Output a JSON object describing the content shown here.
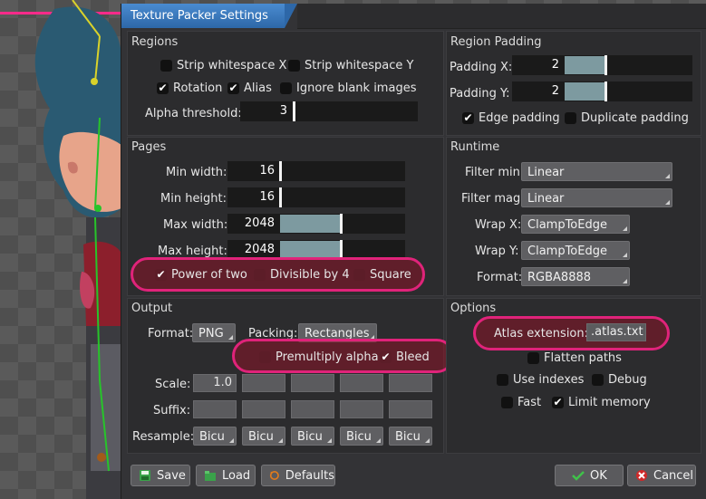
{
  "dialog": {
    "title": "Texture Packer Settings"
  },
  "regions": {
    "title": "Regions",
    "strip_x": {
      "label": "Strip whitespace X",
      "checked": false
    },
    "strip_y": {
      "label": "Strip whitespace Y",
      "checked": false
    },
    "rotation": {
      "label": "Rotation",
      "checked": true
    },
    "alias": {
      "label": "Alias",
      "checked": true
    },
    "ignore_blank": {
      "label": "Ignore blank images",
      "checked": false
    },
    "alpha_label": "Alpha threshold:",
    "alpha_value": "3"
  },
  "padding": {
    "title": "Region Padding",
    "x_label": "Padding X:",
    "x_value": "2",
    "y_label": "Padding Y:",
    "y_value": "2",
    "edge": {
      "label": "Edge padding",
      "checked": true
    },
    "duplicate": {
      "label": "Duplicate padding",
      "checked": false
    }
  },
  "pages": {
    "title": "Pages",
    "min_width_label": "Min width:",
    "min_width": "16",
    "min_height_label": "Min height:",
    "min_height": "16",
    "max_width_label": "Max width:",
    "max_width": "2048",
    "max_height_label": "Max height:",
    "max_height": "2048",
    "pot": {
      "label": "Power of two",
      "checked": true
    },
    "div4": {
      "label": "Divisible by 4",
      "checked": false
    },
    "square": {
      "label": "Square",
      "checked": false
    }
  },
  "runtime": {
    "title": "Runtime",
    "filter_min_label": "Filter min:",
    "filter_min": "Linear",
    "filter_mag_label": "Filter mag:",
    "filter_mag": "Linear",
    "wrap_x_label": "Wrap X:",
    "wrap_x": "ClampToEdge",
    "wrap_y_label": "Wrap Y:",
    "wrap_y": "ClampToEdge",
    "format_label": "Format:",
    "format": "RGBA8888"
  },
  "output": {
    "title": "Output",
    "format_label": "Format:",
    "format": "PNG",
    "packing_label": "Packing:",
    "packing": "Rectangles",
    "premultiply": {
      "label": "Premultiply alpha",
      "checked": false
    },
    "bleed": {
      "label": "Bleed",
      "checked": true
    },
    "scale_label": "Scale:",
    "scale": "1.0",
    "suffix_label": "Suffix:",
    "resample_label": "Resample:",
    "resample": [
      "Bicu",
      "Bicu",
      "Bicu",
      "Bicu",
      "Bicu"
    ]
  },
  "options": {
    "title": "Options",
    "atlas_label": "Atlas extension:",
    "atlas_value": ".atlas.txt",
    "flatten": {
      "label": "Flatten paths",
      "checked": false
    },
    "indexes": {
      "label": "Use indexes",
      "checked": false
    },
    "debug": {
      "label": "Debug",
      "checked": false
    },
    "fast": {
      "label": "Fast",
      "checked": false
    },
    "limit_memory": {
      "label": "Limit memory",
      "checked": true
    }
  },
  "buttons": {
    "save": "Save",
    "load": "Load",
    "defaults": "Defaults",
    "ok": "OK",
    "cancel": "Cancel"
  },
  "colors": {
    "title_accent": "#3b7bc4",
    "highlight": "#e0237a",
    "slider_fill": "#7d9aa0"
  }
}
